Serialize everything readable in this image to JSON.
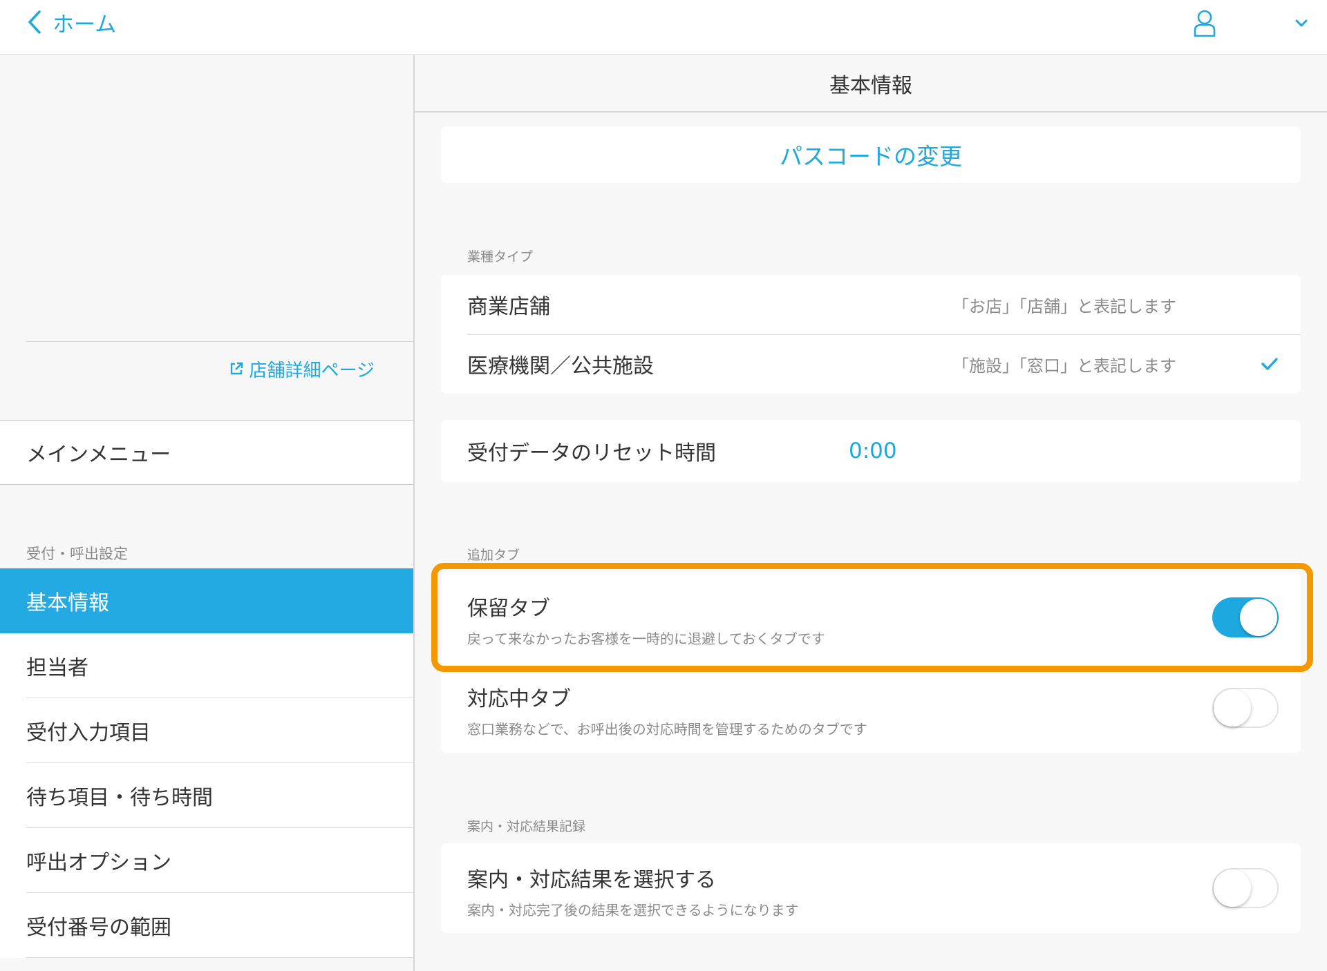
{
  "header": {
    "back_label": "ホーム"
  },
  "sidebar": {
    "store_link": "店舗詳細ページ",
    "main_menu": "メインメニュー",
    "section_label": "受付・呼出設定",
    "items": [
      {
        "label": "基本情報",
        "active": true
      },
      {
        "label": "担当者"
      },
      {
        "label": "受付入力項目"
      },
      {
        "label": "待ち項目・待ち時間"
      },
      {
        "label": "呼出オプション"
      },
      {
        "label": "受付番号の範囲"
      }
    ]
  },
  "content": {
    "title": "基本情報",
    "passcode_button": "パスコードの変更",
    "business_type": {
      "label": "業種タイプ",
      "options": [
        {
          "name": "商業店舗",
          "hint": "「お店」「店舗」と表記します",
          "selected": false
        },
        {
          "name": "医療機関／公共施設",
          "hint": "「施設」「窓口」と表記します",
          "selected": true
        }
      ]
    },
    "reset": {
      "label": "受付データのリセット時間",
      "value": "0:00"
    },
    "extra_tabs": {
      "label": "追加タブ",
      "items": [
        {
          "title": "保留タブ",
          "desc": "戻って来なかったお客様を一時的に退避しておくタブです",
          "on": true
        },
        {
          "title": "対応中タブ",
          "desc": "窓口業務などで、お呼出後の対応時間を管理するためのタブです",
          "on": false
        }
      ]
    },
    "guide": {
      "label": "案内・対応結果記録",
      "items": [
        {
          "title": "案内・対応結果を選択する",
          "desc": "案内・対応完了後の結果を選択できるようになります",
          "on": false
        }
      ]
    }
  },
  "colors": {
    "accent": "#1fa8de",
    "highlight": "#f39800",
    "active_bg": "#24aae2"
  }
}
